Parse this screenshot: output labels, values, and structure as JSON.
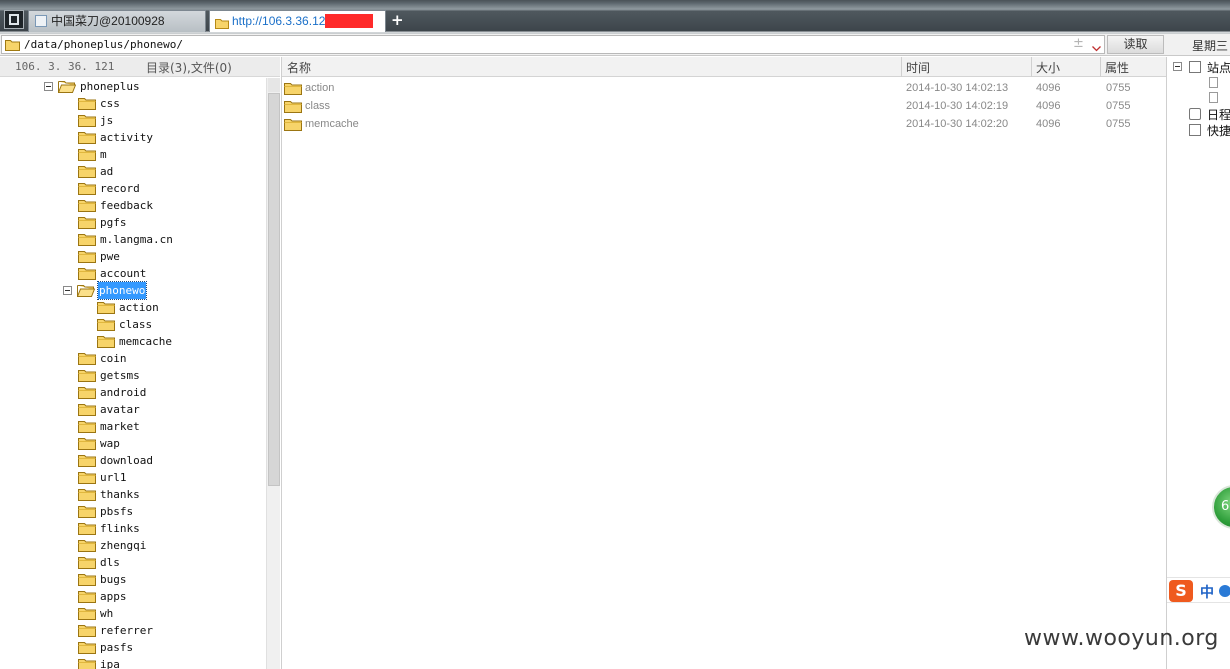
{
  "tabs": [
    {
      "label": "中国菜刀@20100928"
    },
    {
      "label": "http://106.3.36.121"
    }
  ],
  "new_tab_label": "+",
  "address": {
    "path": "/data/phoneplus/phonewo/",
    "plus_symbol": "±",
    "read_button": "读取",
    "date_label": "星期三"
  },
  "left_panel": {
    "host": "106. 3. 36. 121",
    "count_label": "目录(3),文件(0)",
    "root": "phoneplus",
    "children_before": [
      "css",
      "js",
      "activity",
      "m",
      "ad",
      "record",
      "feedback",
      "pgfs",
      "m.langma.cn",
      "pwe",
      "account"
    ],
    "selected": "phonewo",
    "selected_children": [
      "action",
      "class",
      "memcache"
    ],
    "children_after": [
      "coin",
      "getsms",
      "android",
      "avatar",
      "market",
      "wap",
      "download",
      "url1",
      "thanks",
      "pbsfs",
      "flinks",
      "zhengqi",
      "dls",
      "bugs",
      "apps",
      "wh",
      "referrer",
      "pasfs",
      "ipa"
    ]
  },
  "file_list": {
    "columns": {
      "name": "名称",
      "time": "时间",
      "size": "大小",
      "attr": "属性"
    },
    "rows": [
      {
        "name": "action",
        "time": "2014-10-30 14:02:13",
        "size": "4096",
        "attr": "0755"
      },
      {
        "name": "class",
        "time": "2014-10-30 14:02:19",
        "size": "4096",
        "attr": "0755"
      },
      {
        "name": "memcache",
        "time": "2014-10-30 14:02:20",
        "size": "4096",
        "attr": "0755"
      }
    ]
  },
  "right_panel": {
    "items": [
      "站点",
      "日程",
      "快捷"
    ],
    "badge": "6",
    "ime_logo": "S",
    "ime_mode": "中"
  },
  "watermark": "www.wooyun.org",
  "colors": {
    "selection": "#3399ff",
    "redaction": "#ff2a2a",
    "tab_link": "#1b70c9",
    "folder": "#f5c542"
  }
}
